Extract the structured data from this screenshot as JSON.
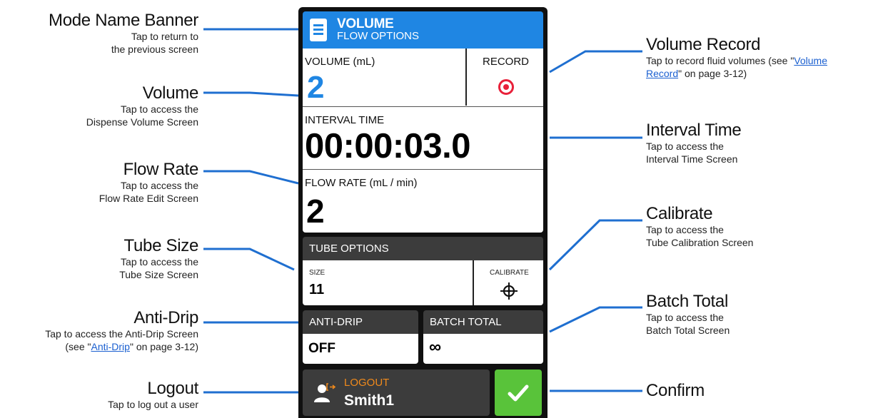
{
  "device": {
    "banner": {
      "title": "VOLUME",
      "subtitle": "FLOW OPTIONS",
      "icon": "document-icon"
    },
    "volume": {
      "label": "VOLUME (mL)",
      "value": "2"
    },
    "record": {
      "label": "RECORD",
      "icon": "record-icon"
    },
    "interval": {
      "label": "INTERVAL TIME",
      "value": "00:00:03.0"
    },
    "flow_rate": {
      "label": "FLOW RATE (mL / min)",
      "value": "2"
    },
    "tube_options": {
      "header": "TUBE OPTIONS",
      "size_label": "SIZE",
      "size_value": "11",
      "calibrate_label": "CALIBRATE",
      "calibrate_icon": "crosshair-icon"
    },
    "anti_drip": {
      "label": "ANTI-DRIP",
      "value": "OFF"
    },
    "batch_total": {
      "label": "BATCH TOTAL",
      "value": "∞"
    },
    "logout": {
      "label": "LOGOUT",
      "user": "Smith1",
      "icon": "user-logout-icon"
    },
    "confirm": {
      "icon": "checkmark-icon"
    },
    "colors": {
      "accent_blue": "#1f86e3",
      "record_red": "#e8213a",
      "logout_orange": "#f08a1c",
      "confirm_green": "#59c33a",
      "panel_dark": "#3c3c3c"
    }
  },
  "callouts": {
    "mode_banner": {
      "title": "Mode Name Banner",
      "desc1": "Tap to return to",
      "desc2": "the previous screen"
    },
    "volume": {
      "title": "Volume",
      "desc1": "Tap to access the",
      "desc2": "Dispense Volume Screen"
    },
    "flow_rate": {
      "title": "Flow Rate",
      "desc1": "Tap to access the",
      "desc2": "Flow Rate Edit Screen"
    },
    "tube_size": {
      "title": "Tube Size",
      "desc1": "Tap to access the",
      "desc2": "Tube Size Screen"
    },
    "anti_drip": {
      "title": "Anti-Drip",
      "desc1": "Tap to access the Anti-Drip Screen",
      "desc2_pre": "(see \"",
      "desc2_link": "Anti-Drip",
      "desc2_post": "\" on page 3-12)"
    },
    "logout": {
      "title": "Logout",
      "desc1": "Tap to log out a user"
    },
    "volume_record": {
      "title": "Volume Record",
      "desc1_pre": "Tap to record fluid volumes (see \"",
      "desc1_link": "Volume",
      "desc2_link": "Record",
      "desc2_post": "\" on page 3-12)"
    },
    "interval_time": {
      "title": "Interval Time",
      "desc1": "Tap to access the",
      "desc2": "Interval Time Screen"
    },
    "calibrate": {
      "title": "Calibrate",
      "desc1": "Tap to access the",
      "desc2": "Tube Calibration Screen"
    },
    "batch_total": {
      "title": "Batch Total",
      "desc1": "Tap to access the",
      "desc2": "Batch Total Screen"
    },
    "confirm": {
      "title": "Confirm"
    }
  }
}
